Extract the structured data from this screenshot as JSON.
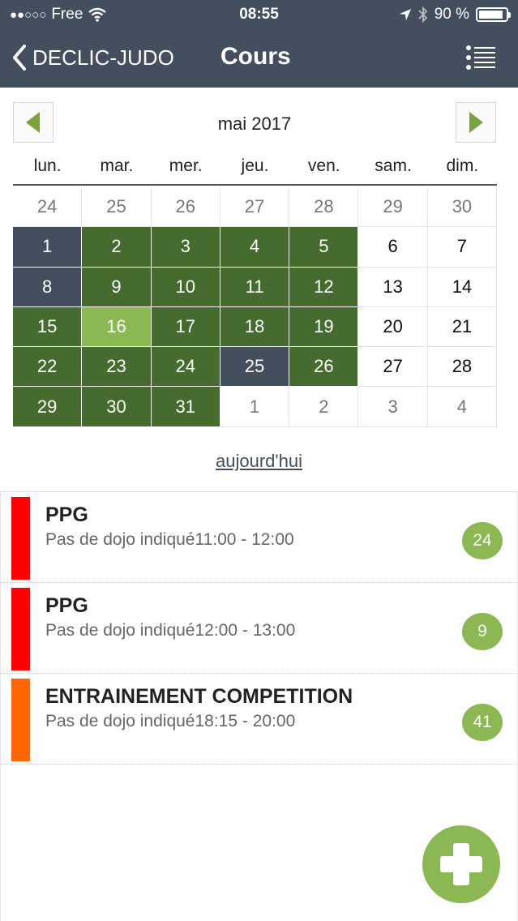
{
  "status": {
    "carrier": "Free",
    "time": "08:55",
    "battery": "90 %",
    "battery_level": 0.9
  },
  "nav": {
    "back_label": "DECLIC-JUDO",
    "title": "Cours"
  },
  "calendar": {
    "month": "mai 2017",
    "weekdays": [
      "lun.",
      "mar.",
      "mer.",
      "jeu.",
      "ven.",
      "sam.",
      "dim."
    ],
    "days": [
      {
        "label": "24",
        "style": "other"
      },
      {
        "label": "25",
        "style": "other"
      },
      {
        "label": "26",
        "style": "other"
      },
      {
        "label": "27",
        "style": "other"
      },
      {
        "label": "28",
        "style": "other"
      },
      {
        "label": "29",
        "style": "other"
      },
      {
        "label": "30",
        "style": "other"
      },
      {
        "label": "1",
        "style": "slate"
      },
      {
        "label": "2",
        "style": "green"
      },
      {
        "label": "3",
        "style": "green"
      },
      {
        "label": "4",
        "style": "green"
      },
      {
        "label": "5",
        "style": "green"
      },
      {
        "label": "6",
        "style": "plain"
      },
      {
        "label": "7",
        "style": "plain"
      },
      {
        "label": "8",
        "style": "slate"
      },
      {
        "label": "9",
        "style": "green"
      },
      {
        "label": "10",
        "style": "green"
      },
      {
        "label": "11",
        "style": "green"
      },
      {
        "label": "12",
        "style": "green"
      },
      {
        "label": "13",
        "style": "plain"
      },
      {
        "label": "14",
        "style": "plain"
      },
      {
        "label": "15",
        "style": "green"
      },
      {
        "label": "16",
        "style": "light"
      },
      {
        "label": "17",
        "style": "green"
      },
      {
        "label": "18",
        "style": "green"
      },
      {
        "label": "19",
        "style": "green"
      },
      {
        "label": "20",
        "style": "plain"
      },
      {
        "label": "21",
        "style": "plain"
      },
      {
        "label": "22",
        "style": "green"
      },
      {
        "label": "23",
        "style": "green"
      },
      {
        "label": "24",
        "style": "green"
      },
      {
        "label": "25",
        "style": "slate"
      },
      {
        "label": "26",
        "style": "green"
      },
      {
        "label": "27",
        "style": "plain"
      },
      {
        "label": "28",
        "style": "plain"
      },
      {
        "label": "29",
        "style": "green"
      },
      {
        "label": "30",
        "style": "green"
      },
      {
        "label": "31",
        "style": "green"
      },
      {
        "label": "1",
        "style": "other"
      },
      {
        "label": "2",
        "style": "other"
      },
      {
        "label": "3",
        "style": "other"
      },
      {
        "label": "4",
        "style": "other"
      }
    ],
    "today_link": "aujourd'hui"
  },
  "courses": [
    {
      "title": "PPG",
      "subtitle": "Pas de dojo indiqué11:00 - 12:00",
      "count": "24",
      "color": "#ff0000"
    },
    {
      "title": "PPG",
      "subtitle": "Pas de dojo indiqué12:00 - 13:00",
      "count": "9",
      "color": "#ff0000"
    },
    {
      "title": "ENTRAINEMENT COMPETITION",
      "subtitle": "Pas de dojo indiqué18:15 - 20:00",
      "count": "41",
      "color": "#ff6600"
    }
  ],
  "icons": {
    "back": "chevron-left-icon",
    "menu": "list-icon",
    "prev": "triangle-left-icon",
    "next": "triangle-right-icon",
    "add": "plus-icon"
  },
  "colors": {
    "header": "#434e5e",
    "dark_green": "#456b2f",
    "light_green": "#8bb852"
  }
}
